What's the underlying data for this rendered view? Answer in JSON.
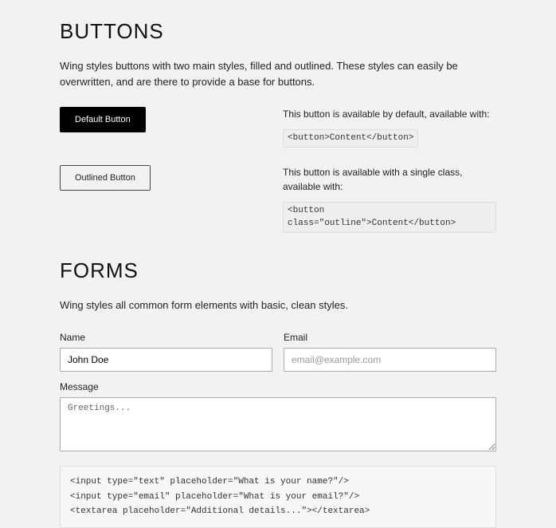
{
  "buttons": {
    "heading": "BUTTONS",
    "intro": "Wing styles buttons with two main styles, filled and outlined. These styles can easily be overwritten, and are there to provide a base for buttons.",
    "default": {
      "label": "Default Button",
      "desc": "This button is available by default, available with:",
      "code": "<button>Content</button>"
    },
    "outlined": {
      "label": "Outlined Button",
      "desc": "This button is available with a single class, available with:",
      "code": "<button class=\"outline\">Content</button>"
    }
  },
  "forms": {
    "heading": "FORMS",
    "intro": "Wing styles all common form elements with basic, clean styles.",
    "name": {
      "label": "Name",
      "value": "John Doe"
    },
    "email": {
      "label": "Email",
      "placeholder": "email@example.com"
    },
    "message": {
      "label": "Message",
      "value": "Greetings..."
    },
    "code": "<input type=\"text\" placeholder=\"What is your name?\"/>\n<input type=\"email\" placeholder=\"What is your email?\"/>\n<textarea placeholder=\"Additional details...\"></textarea>"
  }
}
